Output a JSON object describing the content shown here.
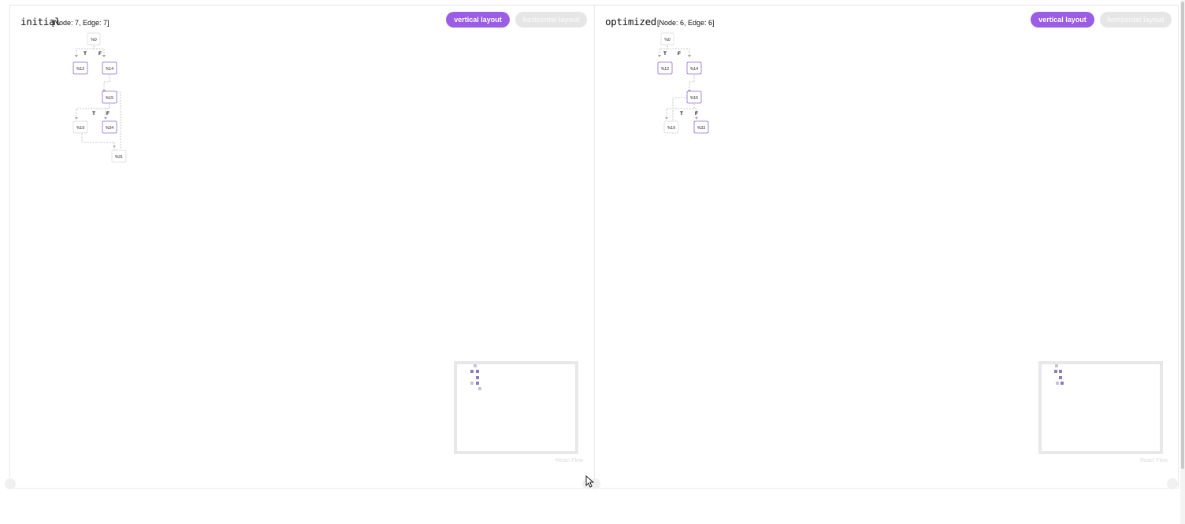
{
  "panels": {
    "left": {
      "title": "initial",
      "meta": "[Node: 7, Edge: 7]",
      "vertical_label": "vertical layout",
      "horizontal_label": "horizontal layout",
      "nodes": [
        "%0",
        "%12",
        "%14",
        "%15",
        "%19",
        "%34",
        "%31"
      ],
      "edge_labels": [
        "T",
        "F",
        "T",
        "F"
      ],
      "attribution": "React Flow"
    },
    "right": {
      "title": "optimized",
      "meta": "[Node: 6, Edge: 6]",
      "vertical_label": "vertical layout",
      "horizontal_label": "horizontal layout",
      "nodes": [
        "%0",
        "%12",
        "%14",
        "%15",
        "%19",
        "%33"
      ],
      "edge_labels": [
        "T",
        "F",
        "T",
        "F"
      ],
      "attribution": "React Flow"
    }
  },
  "colors": {
    "accent": "#9b5de5",
    "inactive_button": "#e6e6e6",
    "node_border": "#d8d8d8",
    "selected_node_border": "#8e6cc9",
    "edge": "#b9b9b9",
    "minimap_node_selected": "#8e7cc3",
    "minimap_node": "#c8c4d8"
  },
  "icons": {
    "cursor": "mouse-pointer-icon",
    "resize": "resize-corner-icon"
  }
}
